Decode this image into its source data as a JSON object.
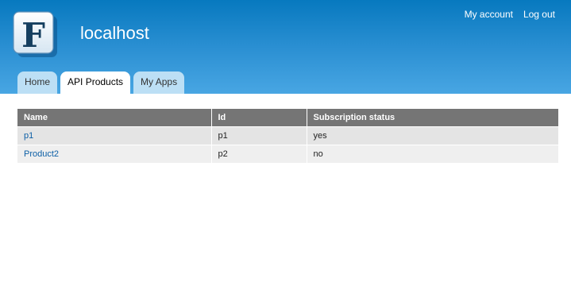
{
  "header": {
    "site_name": "localhost",
    "logo_letter": "F",
    "secondary_menu": {
      "my_account": "My account",
      "log_out": "Log out"
    },
    "tabs": [
      {
        "label": "Home",
        "active": false
      },
      {
        "label": "API Products",
        "active": true
      },
      {
        "label": "My Apps",
        "active": false
      }
    ]
  },
  "table": {
    "columns": [
      "Name",
      "Id",
      "Subscription status"
    ],
    "rows": [
      {
        "name": "p1",
        "id": "p1",
        "status": "yes"
      },
      {
        "name": "Product2",
        "id": "p2",
        "status": "no"
      }
    ]
  },
  "colors": {
    "header_top": "#0779bf",
    "header_bottom": "#48a6e3",
    "tab_inactive": "#bcdff5",
    "table_header": "#757575",
    "link": "#0c5fa6"
  }
}
